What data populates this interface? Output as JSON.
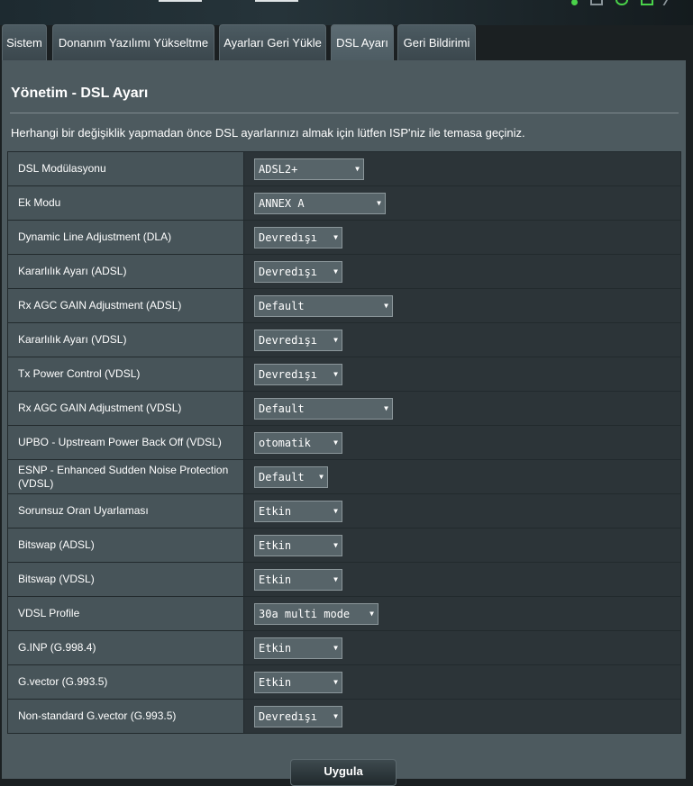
{
  "tabs": [
    {
      "label": "Sistem"
    },
    {
      "label": "Donanım Yazılımı Yükseltme"
    },
    {
      "label": "Ayarları Geri Yükle"
    },
    {
      "label": "DSL Ayarı"
    },
    {
      "label": "Geri Bildirimi"
    }
  ],
  "page": {
    "title": "Yönetim - DSL Ayarı",
    "notice": "Herhangi bir değişiklik yapmadan önce DSL ayarlarınızı almak için lütfen ISP'niz ile temasa geçiniz."
  },
  "settings": [
    {
      "label": "DSL Modülasyonu",
      "value": "ADSL2+"
    },
    {
      "label": "Ek Modu",
      "value": "ANNEX A"
    },
    {
      "label": "Dynamic Line Adjustment (DLA)",
      "value": "Devredışı"
    },
    {
      "label": "Kararlılık Ayarı (ADSL)",
      "value": "Devredışı"
    },
    {
      "label": "Rx AGC GAIN Adjustment (ADSL)",
      "value": "Default"
    },
    {
      "label": "Kararlılık Ayarı (VDSL)",
      "value": "Devredışı"
    },
    {
      "label": "Tx Power Control (VDSL)",
      "value": "Devredışı"
    },
    {
      "label": "Rx AGC GAIN Adjustment (VDSL)",
      "value": "Default"
    },
    {
      "label": "UPBO - Upstream Power Back Off (VDSL)",
      "value": "otomatik"
    },
    {
      "label": "ESNP - Enhanced Sudden Noise Protection (VDSL)",
      "value": "Default"
    },
    {
      "label": "Sorunsuz Oran Uyarlaması",
      "value": "Etkin"
    },
    {
      "label": "Bitswap (ADSL)",
      "value": "Etkin"
    },
    {
      "label": "Bitswap (VDSL)",
      "value": "Etkin"
    },
    {
      "label": "VDSL Profile",
      "value": "30a multi mode"
    },
    {
      "label": "G.INP (G.998.4)",
      "value": "Etkin"
    },
    {
      "label": "G.vector (G.993.5)",
      "value": "Etkin"
    },
    {
      "label": "Non-standard G.vector (G.993.5)",
      "value": "Devredışı"
    }
  ],
  "apply_button": {
    "label": "Uygula"
  },
  "icons": {
    "dropdown": "chevron-down-icon",
    "status": [
      "status-dot-icon",
      "network-icon",
      "wifi-icon",
      "usb-icon",
      "share-icon"
    ]
  },
  "colors": {
    "panel": "#4d5a5f",
    "label_cell": "#475459",
    "value_cell": "#2c3438",
    "accent_green": "#4ad24a"
  }
}
